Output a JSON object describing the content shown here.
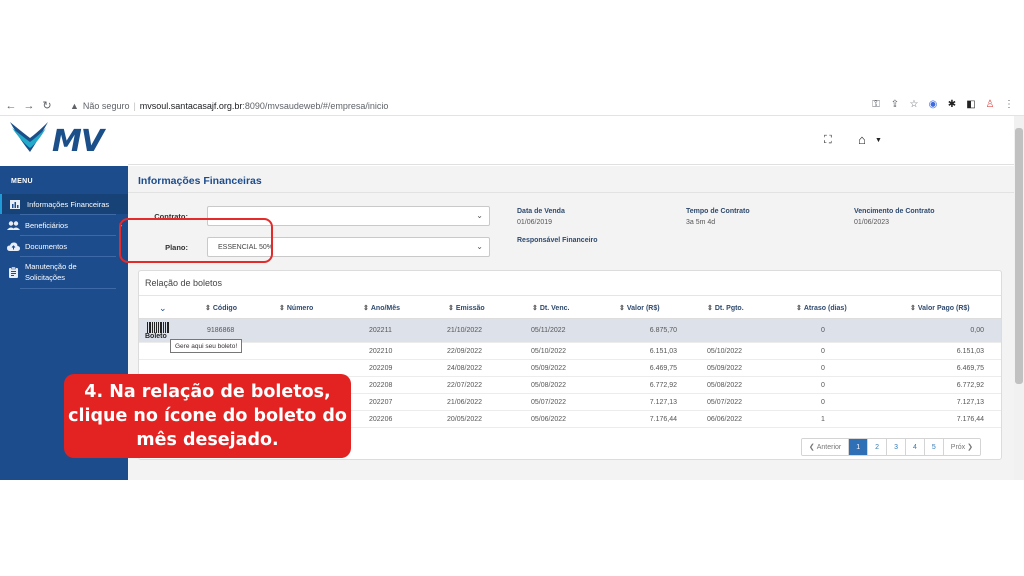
{
  "browser": {
    "security_label": "Não seguro",
    "url_host": "mvsoul.santacasajf.org.br",
    "url_path": ":8090/mvsaudeweb/#/empresa/inicio"
  },
  "app": {
    "logo_text": "MV"
  },
  "sidebar": {
    "menu_title": "MENU",
    "items": [
      {
        "label": "Informações Financeiras",
        "icon": "chart-icon"
      },
      {
        "label": "Beneficiários",
        "icon": "users-icon"
      },
      {
        "label": "Documentos",
        "icon": "cloud-icon"
      },
      {
        "label": "Manutenção de Solicitações",
        "icon": "clipboard-icon"
      }
    ]
  },
  "page": {
    "title": "Informações Financeiras",
    "contrato_label": "Contrato:",
    "contrato_value": "",
    "plano_label": "Plano:",
    "plano_value": "ESSENCIAL 50%",
    "data_venda_label": "Data de Venda",
    "data_venda_value": "01/06/2019",
    "responsavel_label": "Responsável Financeiro",
    "tempo_contrato_label": "Tempo de Contrato",
    "tempo_contrato_value": "3a 5m 4d",
    "vencimento_label": "Vencimento de Contrato",
    "vencimento_value": "01/06/2023"
  },
  "boletos": {
    "title": "Relação de boletos",
    "columns": [
      "Código",
      "Número",
      "Ano/Mês",
      "Emissão",
      "Dt. Venc.",
      "Valor (R$)",
      "Dt. Pgto.",
      "Atraso (dias)",
      "Valor Pago (R$)"
    ],
    "barcode_label": "Boleto",
    "tooltip": "Gere aqui seu boleto!",
    "rows": [
      {
        "codigo": "9186868",
        "numero": "",
        "ano_mes": "202211",
        "emissao": "21/10/2022",
        "venc": "05/11/2022",
        "valor": "6.875,70",
        "pgto": "",
        "atraso": "0",
        "valor_pago": "0,00"
      },
      {
        "codigo": "",
        "numero": "",
        "ano_mes": "202210",
        "emissao": "22/09/2022",
        "venc": "05/10/2022",
        "valor": "6.151,03",
        "pgto": "05/10/2022",
        "atraso": "0",
        "valor_pago": "6.151,03"
      },
      {
        "codigo": "",
        "numero": "",
        "ano_mes": "202209",
        "emissao": "24/08/2022",
        "venc": "05/09/2022",
        "valor": "6.469,75",
        "pgto": "05/09/2022",
        "atraso": "0",
        "valor_pago": "6.469,75"
      },
      {
        "codigo": "",
        "numero": "",
        "ano_mes": "202208",
        "emissao": "22/07/2022",
        "venc": "05/08/2022",
        "valor": "6.772,92",
        "pgto": "05/08/2022",
        "atraso": "0",
        "valor_pago": "6.772,92"
      },
      {
        "codigo": "",
        "numero": "",
        "ano_mes": "202207",
        "emissao": "21/06/2022",
        "venc": "05/07/2022",
        "valor": "7.127,13",
        "pgto": "05/07/2022",
        "atraso": "0",
        "valor_pago": "7.127,13"
      },
      {
        "codigo": "",
        "numero": "",
        "ano_mes": "202206",
        "emissao": "20/05/2022",
        "venc": "05/06/2022",
        "valor": "7.176,44",
        "pgto": "06/06/2022",
        "atraso": "1",
        "valor_pago": "7.176,44"
      }
    ],
    "pager": {
      "prev": "Anterior",
      "pages": [
        "1",
        "2",
        "3",
        "4",
        "5"
      ],
      "next": "Próx",
      "current": "1"
    }
  },
  "callout": {
    "lines": [
      "4. Na relação de boletos,",
      "clique no ícone do boleto do",
      "mês desejado."
    ]
  },
  "colors": {
    "sidebar": "#1c4c8c",
    "accent": "#e32222",
    "active_page": "#2f6fb5"
  }
}
